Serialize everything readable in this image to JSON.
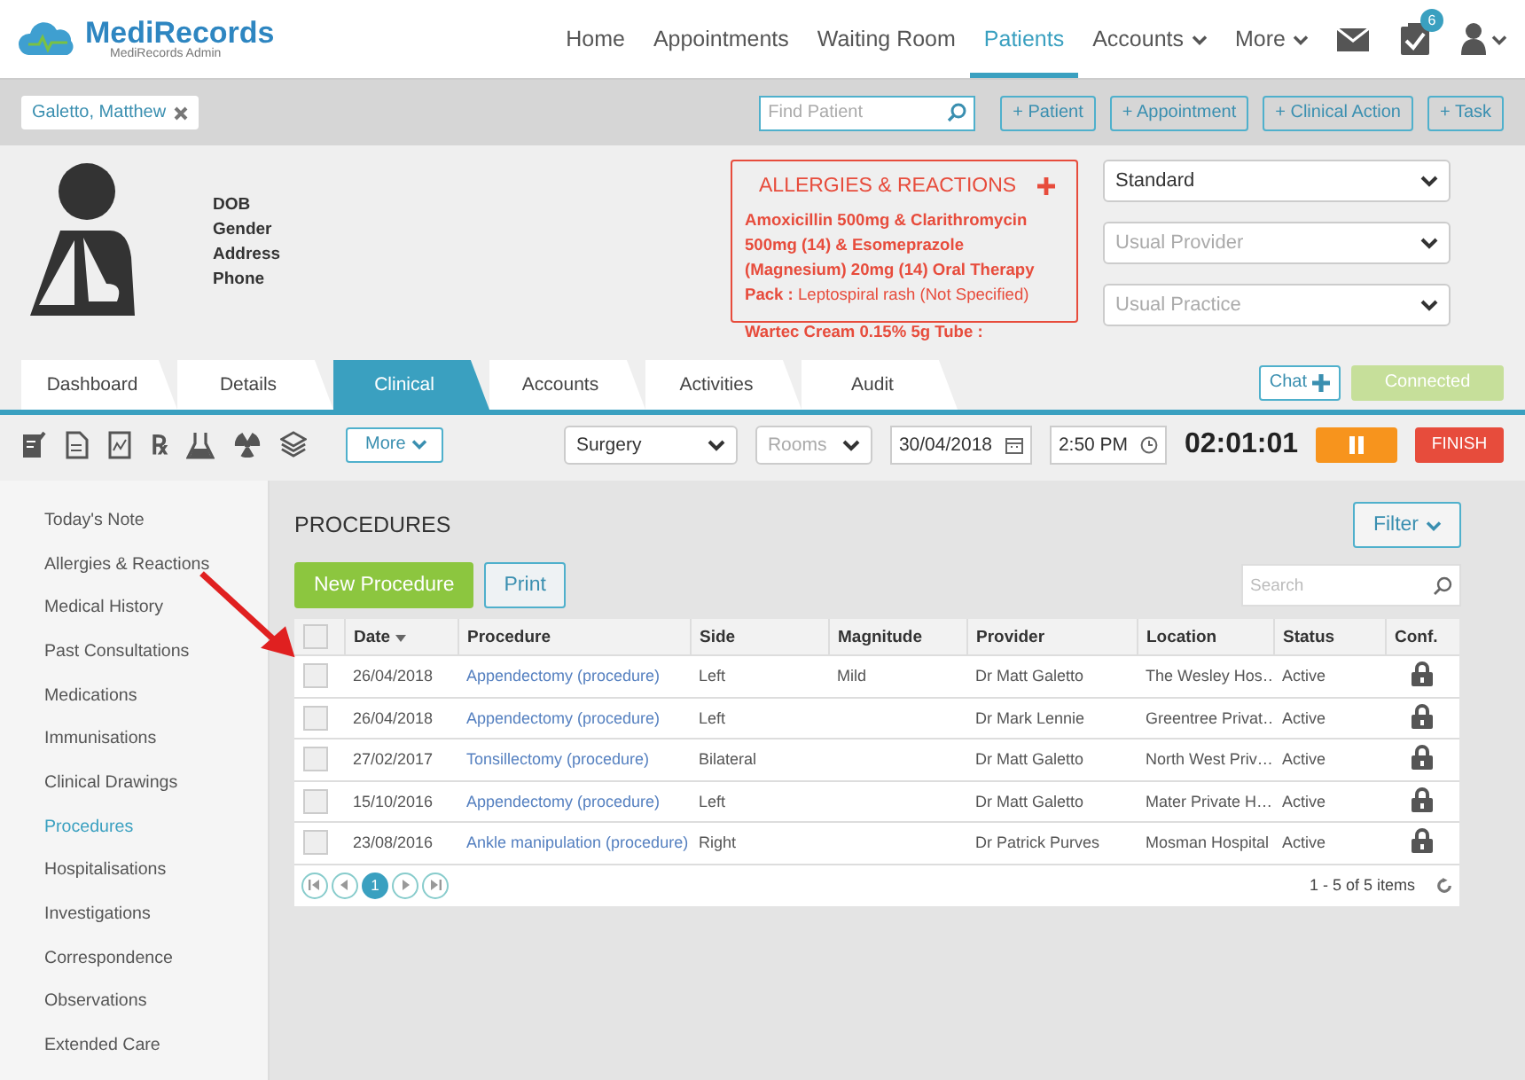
{
  "app": {
    "logo_name": "MediRecords",
    "logo_subtitle": "MediRecords Admin"
  },
  "nav": [
    {
      "label": "Home",
      "selected": false,
      "dropdown": false
    },
    {
      "label": "Appointments",
      "selected": false,
      "dropdown": false
    },
    {
      "label": "Waiting Room",
      "selected": false,
      "dropdown": false
    },
    {
      "label": "Patients",
      "selected": true,
      "dropdown": false
    },
    {
      "label": "Accounts",
      "selected": false,
      "dropdown": true
    },
    {
      "label": "More",
      "selected": false,
      "dropdown": true
    }
  ],
  "task_badge": "6",
  "patient_bar": {
    "open_patient": "Galetto, Matthew",
    "search": {
      "placeholder": "Find Patient"
    },
    "actions": [
      "+ Patient",
      "+ Appointment",
      "+ Clinical Action",
      "+ Task"
    ]
  },
  "patient": {
    "fields": [
      "DOB",
      "Gender",
      "Address",
      "Phone"
    ]
  },
  "allergies": {
    "title": "ALLERGIES & REACTIONS",
    "items": [
      {
        "text": "**Amoxicillin 500mg & Clarithromycin 500mg (14) & Esomeprazole (Magnesium) 20mg (14) Oral Therapy Pack :** Leptospiral rash (Not Specified)"
      }
    ],
    "overflow": "Wartec Cream 0.15% 5g Tube :"
  },
  "patient_selects": [
    {
      "value": "Standard"
    },
    {
      "placeholder": "Usual Provider"
    },
    {
      "placeholder": "Usual Practice"
    }
  ],
  "tabs": [
    {
      "label": "Dashboard",
      "selected": false
    },
    {
      "label": "Details",
      "selected": false
    },
    {
      "label": "Clinical",
      "selected": true
    },
    {
      "label": "Accounts",
      "selected": false
    },
    {
      "label": "Activities",
      "selected": false
    },
    {
      "label": "Audit",
      "selected": false
    }
  ],
  "chat": "Chat",
  "connection": "Connected",
  "toolbar": {
    "rx_icon": "℞",
    "more": "More",
    "location": "Surgery",
    "rooms_placeholder": "Rooms",
    "date": "30/04/2018",
    "time": "2:50 PM",
    "timer": "02:01:01",
    "finish": "FINISH"
  },
  "sidebar": {
    "items": [
      {
        "label": "Today's Note",
        "selected": false
      },
      {
        "label": "Allergies & Reactions",
        "selected": false
      },
      {
        "label": "Medical History",
        "selected": false
      },
      {
        "label": "Past Consultations",
        "selected": false
      },
      {
        "label": "Medications",
        "selected": false
      },
      {
        "label": "Immunisations",
        "selected": false
      },
      {
        "label": "Clinical Drawings",
        "selected": false
      },
      {
        "label": "Procedures",
        "selected": true
      },
      {
        "label": "Hospitalisations",
        "selected": false
      },
      {
        "label": "Investigations",
        "selected": false
      },
      {
        "label": "Correspondence",
        "selected": false
      },
      {
        "label": "Observations",
        "selected": false
      },
      {
        "label": "Extended Care",
        "selected": false
      }
    ]
  },
  "procedures": {
    "title": "PROCEDURES",
    "filter": "Filter",
    "new_button": "New Procedure",
    "print_button": "Print",
    "search": {
      "placeholder": "Search"
    },
    "all_checked": false,
    "columns": [
      "Date",
      "Procedure",
      "Side",
      "Magnitude",
      "Provider",
      "Location",
      "Status",
      "Conf."
    ],
    "rows": [
      {
        "checked": false,
        "date": "26/04/2018",
        "procedure": "Appendectomy (procedure)",
        "side": "Left",
        "magnitude": "Mild",
        "provider": "Dr Matt Galetto",
        "location": "The Wesley Hos…",
        "status": "Active"
      },
      {
        "checked": false,
        "date": "26/04/2018",
        "procedure": "Appendectomy (procedure)",
        "side": "Left",
        "magnitude": "",
        "provider": "Dr Mark Lennie",
        "location": "Greentree Privat…",
        "status": "Active"
      },
      {
        "checked": false,
        "date": "27/02/2017",
        "procedure": "Tonsillectomy (procedure)",
        "side": "Bilateral",
        "magnitude": "",
        "provider": "Dr Matt Galetto",
        "location": "North West Priv…",
        "status": "Active"
      },
      {
        "checked": false,
        "date": "15/10/2016",
        "procedure": "Appendectomy (procedure)",
        "side": "Left",
        "magnitude": "",
        "provider": "Dr Matt Galetto",
        "location": "Mater Private H…",
        "status": "Active"
      },
      {
        "checked": false,
        "date": "23/08/2016",
        "procedure": "Ankle manipulation (procedure)",
        "side": "Right",
        "magnitude": "",
        "provider": "Dr Patrick Purves",
        "location": "Mosman Hospital",
        "status": "Active"
      }
    ],
    "pages": [
      {
        "label": "1",
        "selected": true
      }
    ],
    "summary": "1 - 5 of 5 items"
  }
}
